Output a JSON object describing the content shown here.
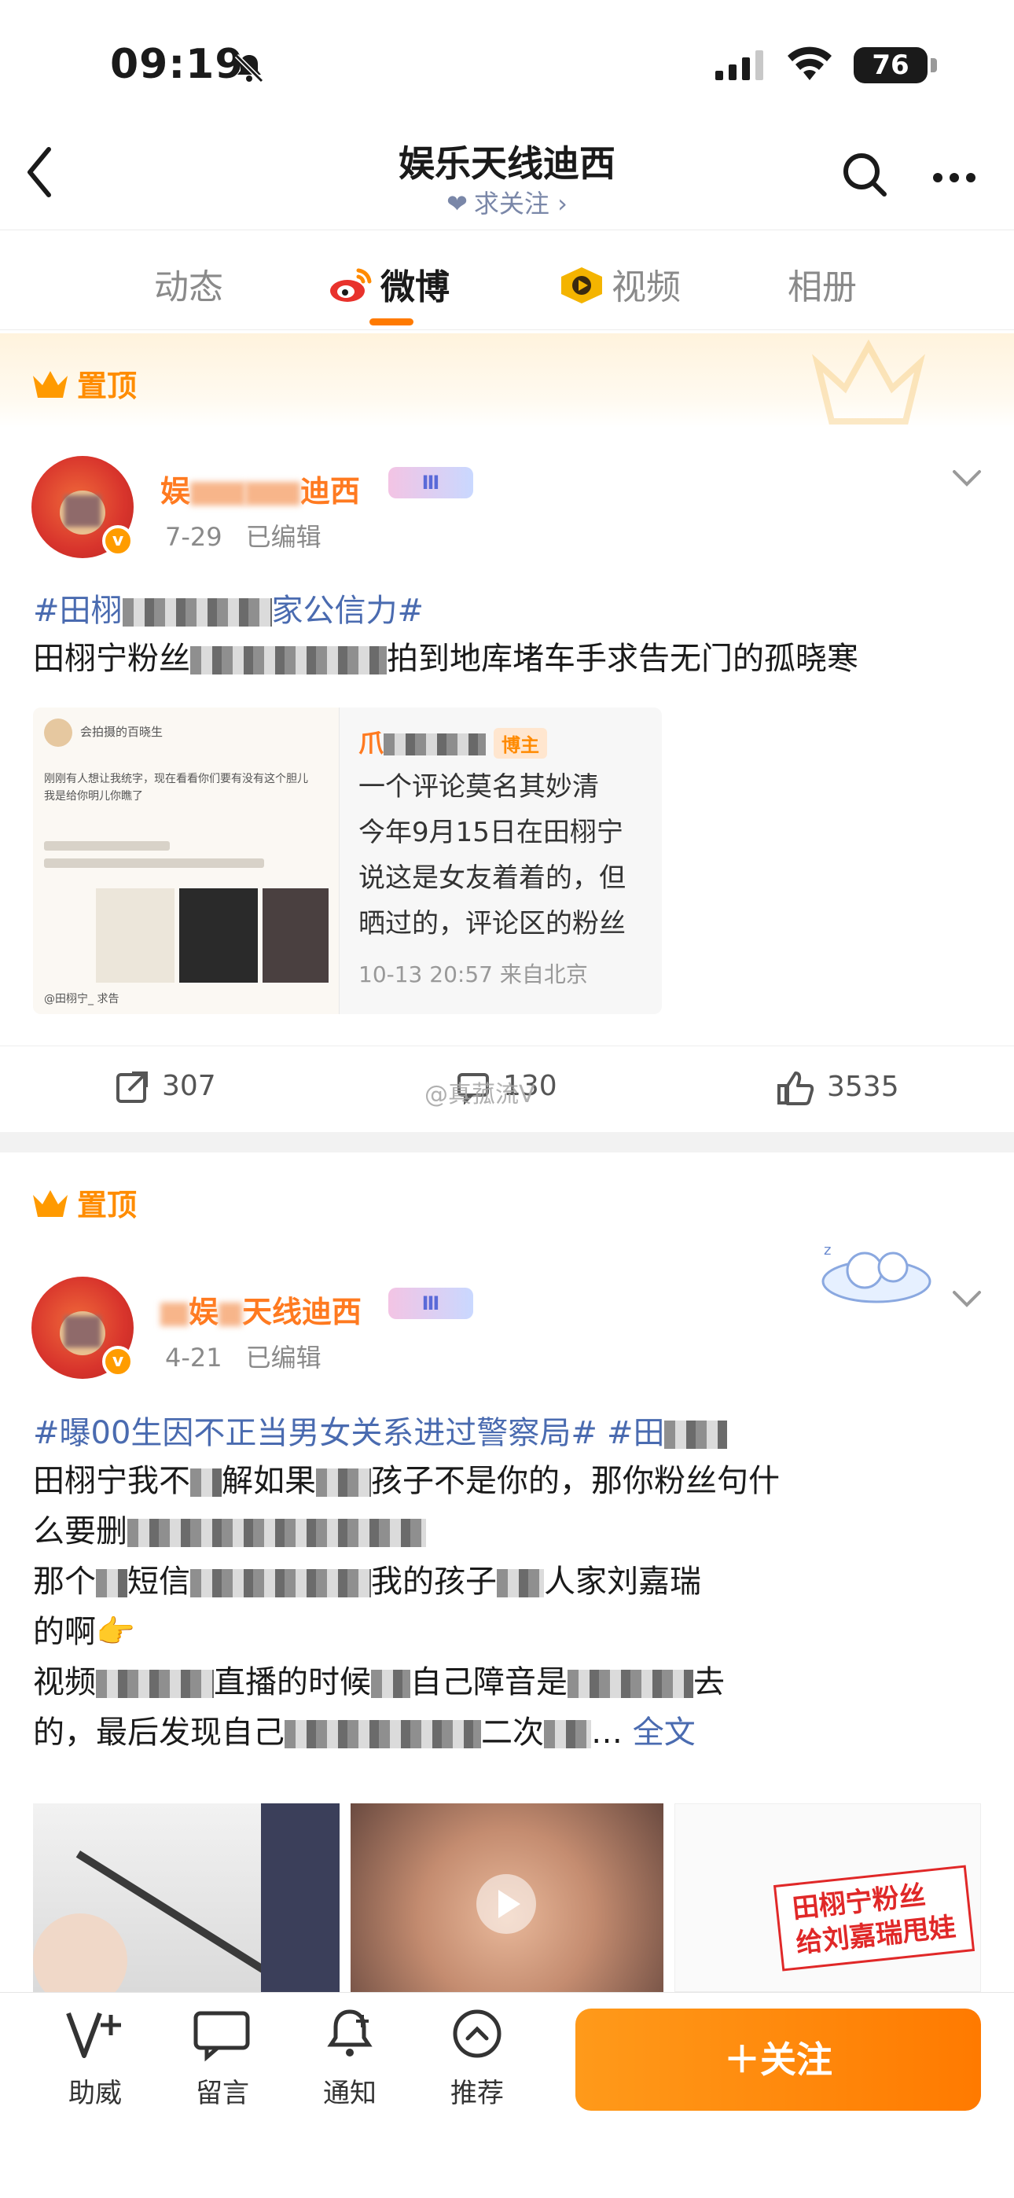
{
  "status_bar": {
    "time": "09:19",
    "battery": "76"
  },
  "header": {
    "title": "娱乐天线迪西",
    "subtitle": "求关注 ›"
  },
  "tabs": [
    {
      "label": "动态"
    },
    {
      "label": "微博"
    },
    {
      "label": "视频"
    },
    {
      "label": "相册"
    }
  ],
  "pinned_label": "置顶",
  "posts": [
    {
      "username_left": "娱",
      "username_right": "迪西",
      "level": "Ⅲ",
      "date": "7-29",
      "edited": "已编辑",
      "topic_start": "#田栩",
      "topic_end": "家公信力#",
      "text_line1_start": "田栩宁粉丝",
      "text_line1_end": "拍到地库堵车手求告无门的孤晓寒",
      "repost": {
        "author": "爪",
        "author_badge": "博主",
        "line1": "一个评论莫名其妙清",
        "line2": "今年9月15日在田栩宁",
        "line3": "说这是女友着着的，但",
        "line4": "晒过的，评论区的粉丝",
        "time": "10-13 20:57 来自北京",
        "thumb_caption": "会拍摄的百晓生",
        "thumb_line": "刚刚有人想让我统字，现在看看你们要有没有这个胆儿 我是给你明儿你瞧了",
        "thumb_foot": "@田栩宁_ 求告"
      },
      "reposts": "307",
      "comments": "130",
      "likes": "3535",
      "watermark": "@真菰流V"
    },
    {
      "username_left": "娱",
      "username_right": "天线迪西",
      "level": "Ⅲ",
      "date": "4-21",
      "edited": "已编辑",
      "topic_start": "#曝00生因不正当男女关系进过警察局#",
      "topic_end": "#田",
      "line1_start": "田栩宁我不",
      "line1_mid": "解如果",
      "line1_end": "孩子不是你的，那你粉丝句什",
      "line2_start": "么要删",
      "line2_end": "",
      "line3_start": "那个",
      "line3_mid": "短信",
      "line3_end": "我的孩子",
      "line3_tail": "人家刘嘉瑞",
      "line4": "的啊",
      "line5_start": "视频",
      "line5_mid": "直播的时候",
      "line5_end": "自己障音是",
      "line5_tail": "去",
      "line6_start": "的，最后发现自己",
      "line6_end": "二次",
      "fulltext": "全文",
      "sticker_line1": "田栩宁粉丝",
      "sticker_line2": "给刘嘉瑞甩娃"
    }
  ],
  "bottom_bar": {
    "items": [
      {
        "label": "助威"
      },
      {
        "label": "留言"
      },
      {
        "label": "通知"
      },
      {
        "label": "推荐"
      }
    ],
    "follow": "＋关注"
  }
}
